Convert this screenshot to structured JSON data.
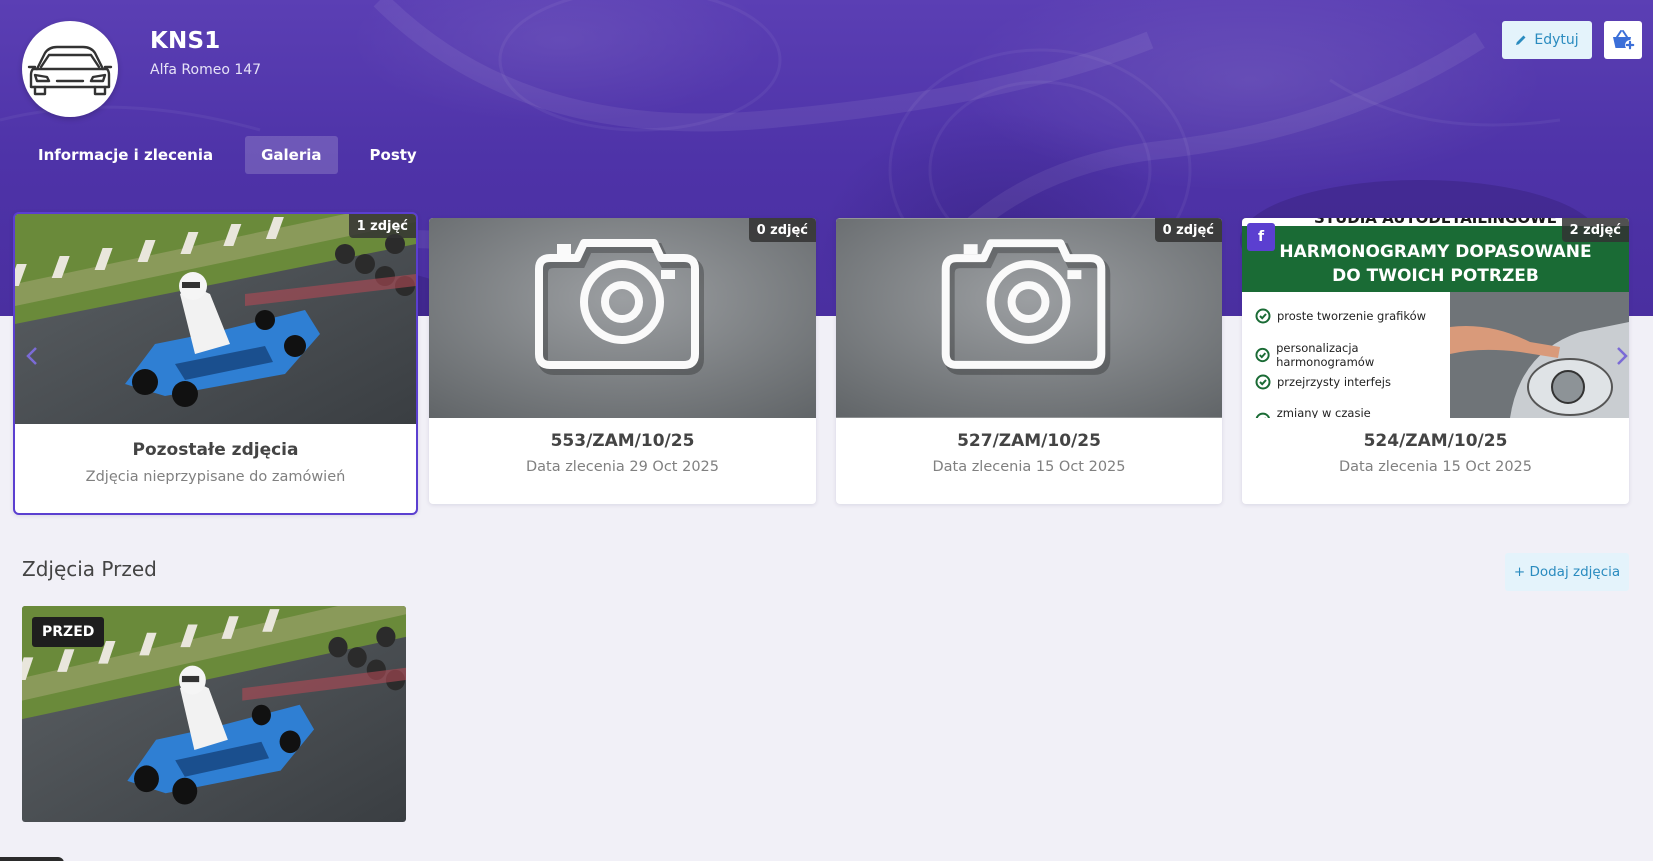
{
  "vehicle": {
    "plate": "KNS1",
    "model": "Alfa Romeo 147"
  },
  "header_buttons": {
    "edit_label": "Edytuj"
  },
  "tabs": [
    {
      "label": "Informacje i zlecenia",
      "active": false
    },
    {
      "label": "Galeria",
      "active": true
    },
    {
      "label": "Posty",
      "active": false
    }
  ],
  "gallery_cards": [
    {
      "badge": "1 zdjęć",
      "title": "Pozostałe zdjęcia",
      "subtitle": "Zdjęcia nieprzypisane do zamówień",
      "selected": true
    },
    {
      "badge": "0 zdjęć",
      "title": "553/ZAM/10/25",
      "subtitle": "Data zlecenia 29 Oct 2025",
      "selected": false
    },
    {
      "badge": "0 zdjęć",
      "title": "527/ZAM/10/25",
      "subtitle": "Data zlecenia 15 Oct 2025",
      "selected": false
    },
    {
      "badge": "2 zdjęć",
      "title": "524/ZAM/10/25",
      "subtitle": "Data zlecenia 15 Oct 2025",
      "selected": false
    }
  ],
  "promo_image": {
    "top_strip": "STUDIA AUTODETAILINGOWE",
    "headline_1": "HARMONOGRAMY DOPASOWANE",
    "headline_2": "DO TWOICH POTRZEB",
    "bullets": [
      "proste tworzenie grafików",
      "personalizacja harmonogramów",
      "przejrzysty interfejs",
      "zmiany w czasie rzeczywistym"
    ],
    "social_icon_glyph": "f"
  },
  "section": {
    "title": "Zdjęcia Przed",
    "add_label": "+ Dodaj zdjęcia",
    "photo_badge": "PRZED"
  },
  "colors": {
    "banner": "#4e33a8",
    "accent": "#5b3fd0",
    "info_button_bg": "#e4f3fb",
    "info_button_text": "#2a8bbf",
    "promo_green": "#1a6b35"
  },
  "icons": {
    "avatar": "car-front-icon",
    "edit": "pencil-icon",
    "cart": "basket-plus-icon",
    "carousel_prev": "chevron-left-icon",
    "carousel_next": "chevron-right-icon",
    "placeholder": "camera-icon",
    "social": "facebook-icon",
    "bullet": "check-circle-icon"
  }
}
